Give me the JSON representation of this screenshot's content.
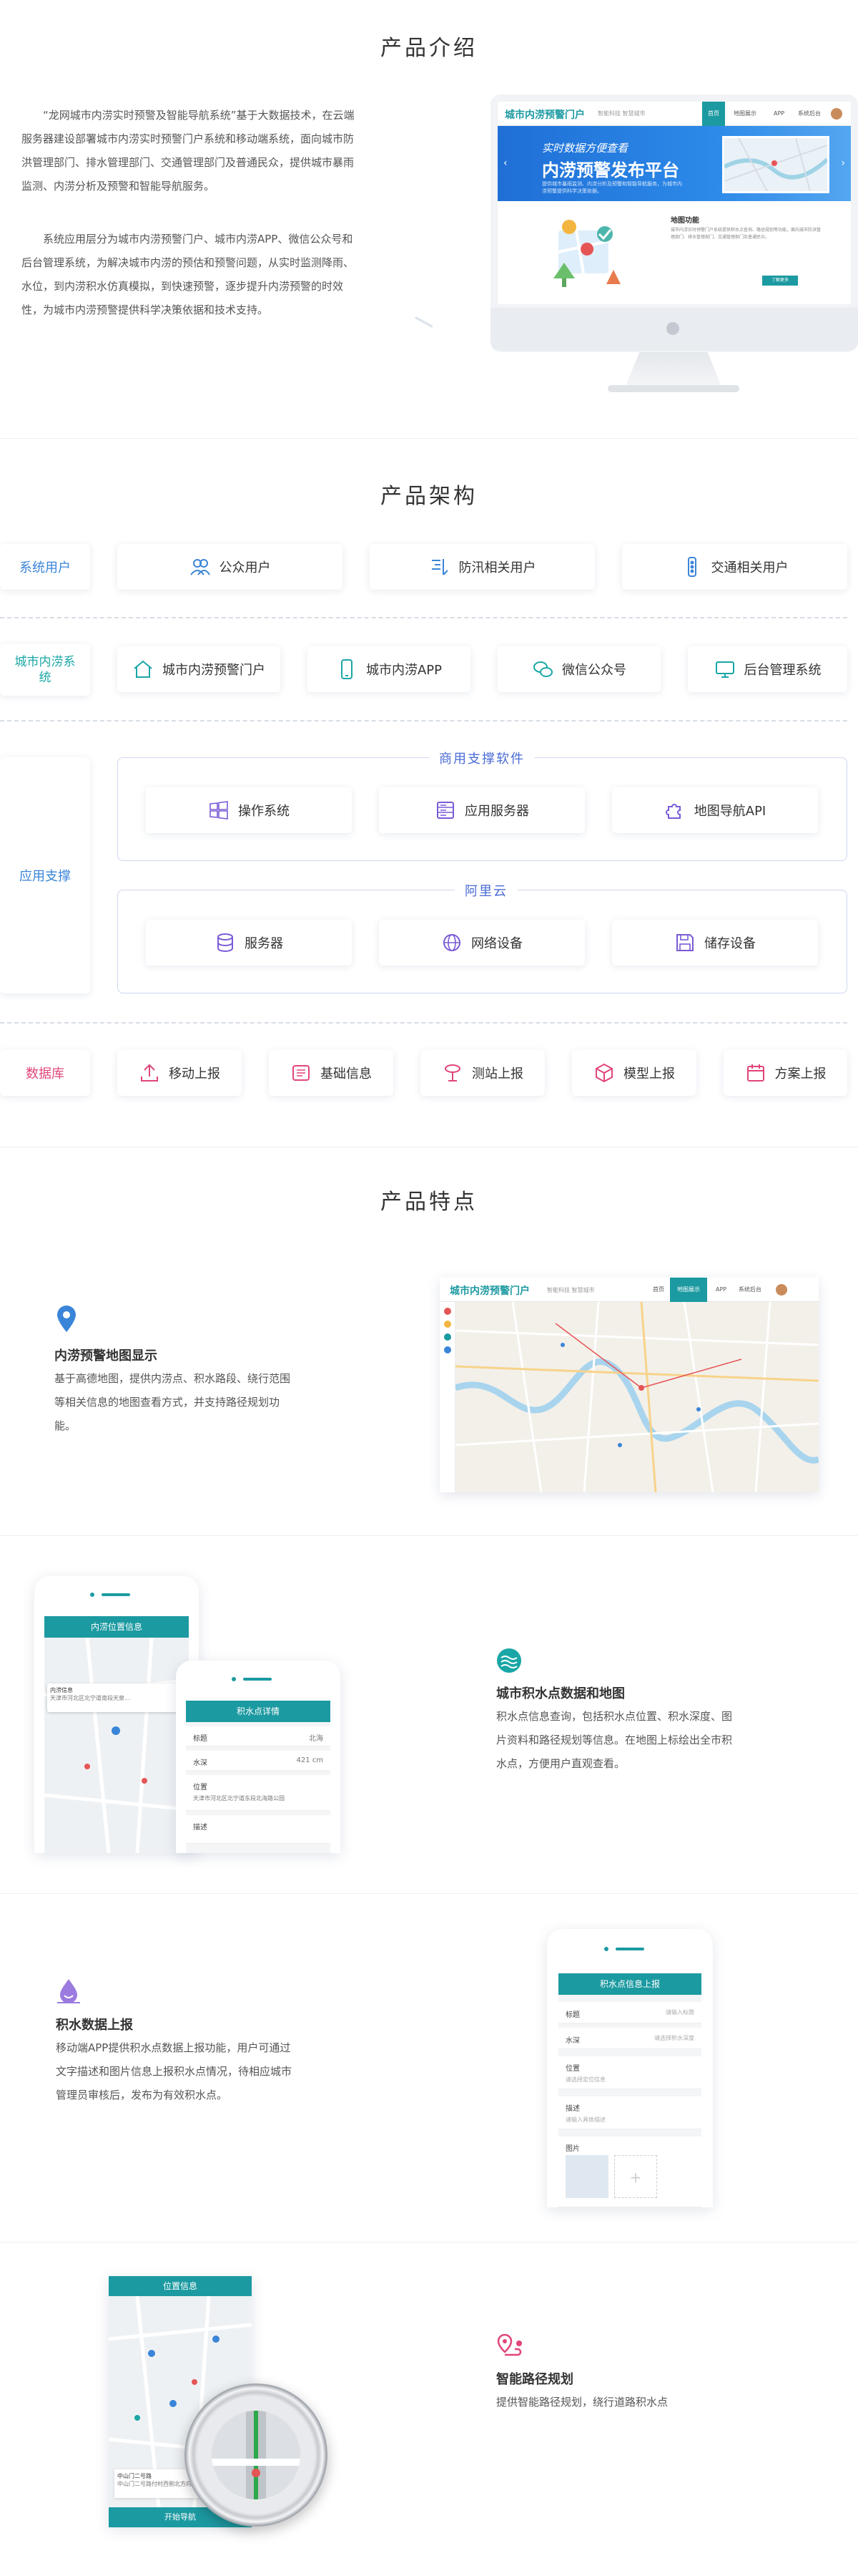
{
  "sections": {
    "intro": "产品介绍",
    "architecture": "产品架构",
    "features": "产品特点"
  },
  "intro": {
    "p1": "“龙网城市内涝实时预警及智能导航系统”基于大数据技术，在云端服务器建设部署城市内涝实时预警门户系统和移动端系统，面向城市防洪管理部门、排水管理部门、交通管理部门及普通民众，提供城市暴雨监测、内涝分析及预警和智能导航服务。",
    "p2": "系统应用层分为城市内涝预警门户、城市内涝APP、微信公众号和后台管理系统，为解决城市内涝的预估和预警问题，从实时监测降雨、水位，到内涝积水仿真模拟，到快速预警，逐步提升内涝预警的时效性，为城市内涝预警提供科学决策依据和技术支持。"
  },
  "portal": {
    "logo": "城市内涝预警门户",
    "subtitle": "智能科技 智慧城市",
    "nav": [
      "首页",
      "地图展示",
      "APP",
      "系统后台"
    ],
    "banner_line1": "实时数据方便查看",
    "banner_line2": "内涝预警发布平台",
    "banner_text": "提供城市暴雨监测、内涝分析及预警和智能导航服务，为城市内涝预警提供科学决策依据。",
    "content_title": "地图功能",
    "content_text": "城市内涝实时预警门户系统提供积水点查询、路径规划等功能，面向城市防洪管理部门、排水管理部门、交通管理部门及普通民众。",
    "content_button": "了解更多"
  },
  "architecture": {
    "row1_label": "系统用户",
    "row1": [
      "公众用户",
      "防汛相关用户",
      "交通相关用户"
    ],
    "row2_label": "城市内涝系统",
    "row2": [
      "城市内涝预警门户",
      "城市内涝APP",
      "微信公众号",
      "后台管理系统"
    ],
    "row3_label": "应用支撑",
    "group1_title": "商用支撑软件",
    "group1": [
      "操作系统",
      "应用服务器",
      "地图导航API"
    ],
    "group2_title": "阿里云",
    "group2": [
      "服务器",
      "网络设备",
      "储存设备"
    ],
    "row4_label": "数据库",
    "row4": [
      "移动上报",
      "基础信息",
      "测站上报",
      "模型上报",
      "方案上报"
    ]
  },
  "features": {
    "f1_title": "内涝预警地图显示",
    "f1_desc": "基于高德地图，提供内涝点、积水路段、绕行范围等相关信息的地图查看方式，并支持路径规划功能。",
    "f2_title": "城市积水点数据和地图",
    "f2_desc": "积水点信息查询，包括积水点位置、积水深度、图片资料和路径规划等信息。在地图上标绘出全市积水点，方便用户直观查看。",
    "f3_title": "积水数据上报",
    "f3_desc": "移动端APP提供积水点数据上报功能，用户可通过文字描述和图片信息上报积水点情况，待相应城市管理员审核后，发布为有效积水点。",
    "f4_title": "智能路径规划",
    "f4_desc": "提供智能路径规划，绕行道路积水点"
  },
  "phones": {
    "p1_header": "内涝位置信息",
    "p1_card_title": "内涝信息",
    "p1_card_text": "天津市河北区北宁道南段天泉...",
    "p2_header": "积水点详情",
    "p2_rows": [
      "标题",
      "水深",
      "位置",
      "描述"
    ],
    "p2_values": [
      "北海",
      "421 cm",
      "天津市河北区北宁道东段北海路公园",
      ""
    ],
    "p3_header": "积水点信息上报",
    "p3_rows": [
      "标题",
      "水深",
      "位置",
      "描述",
      "图片"
    ],
    "p3_values": [
      "请输入标题",
      "请选择积水深度",
      "请选择定位信息",
      "请输入具体描述",
      ""
    ],
    "p4_header": "位置信息",
    "p4_bottom": "开始导航",
    "p4_loc1": "中山门二号路",
    "p4_loc2": "中山门二号路付村西侧北方向"
  },
  "colors": {
    "teal": "#1c9aa1",
    "blue": "#3a85d8",
    "pink": "#e0457b",
    "purple": "#7a5bd6"
  }
}
